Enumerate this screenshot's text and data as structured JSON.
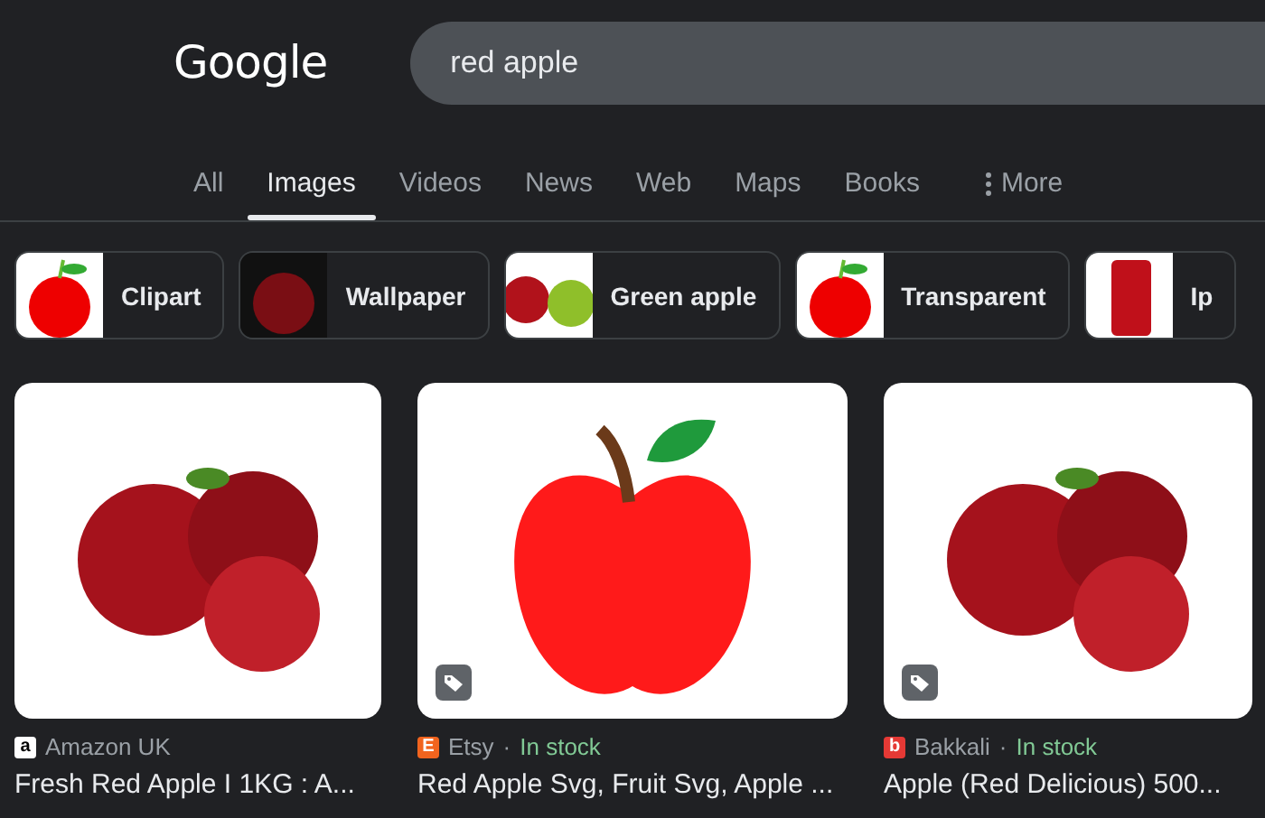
{
  "logo": "Google",
  "search": {
    "value": "red apple"
  },
  "tabs": [
    {
      "label": "All",
      "selected": false
    },
    {
      "label": "Images",
      "selected": true
    },
    {
      "label": "Videos",
      "selected": false
    },
    {
      "label": "News",
      "selected": false
    },
    {
      "label": "Web",
      "selected": false
    },
    {
      "label": "Maps",
      "selected": false
    },
    {
      "label": "Books",
      "selected": false
    },
    {
      "label": "More",
      "selected": false,
      "kind": "menu"
    }
  ],
  "chips": [
    {
      "label": "Clipart",
      "kind": "clipart"
    },
    {
      "label": "Wallpaper",
      "kind": "dark"
    },
    {
      "label": "Green apple",
      "kind": "pair"
    },
    {
      "label": "Transparent",
      "kind": "clipart"
    },
    {
      "label": "Ip",
      "kind": "phone"
    }
  ],
  "results": [
    {
      "kind": "photo",
      "tagged": false,
      "favicon": "a",
      "color": "#ffffff",
      "source": "Amazon UK",
      "title": "Fresh Red Apple I 1KG : A..."
    },
    {
      "kind": "clipart",
      "tagged": true,
      "favicon": "E",
      "color": "#f1641e",
      "source": "Etsy",
      "separator": "·",
      "stock": "In stock",
      "title": "Red Apple Svg, Fruit Svg, Apple ..."
    },
    {
      "kind": "photo",
      "tagged": true,
      "favicon": "b",
      "color": "#e53935",
      "source": "Bakkali",
      "separator": "·",
      "stock": "In stock",
      "title": "Apple (Red Delicious) 500..."
    }
  ]
}
